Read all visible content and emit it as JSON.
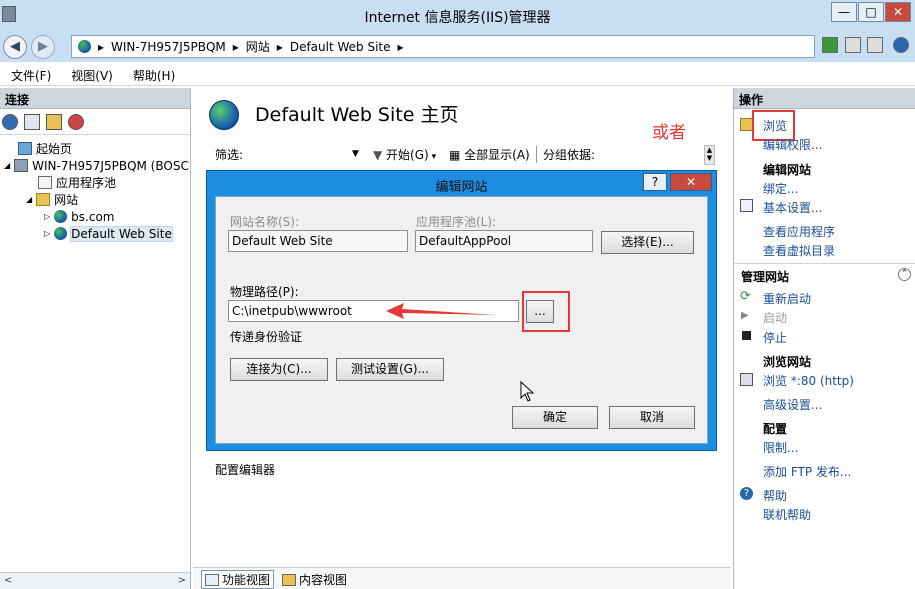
{
  "window": {
    "title": "Internet 信息服务(IIS)管理器",
    "controls": [
      "—",
      "□",
      "✕"
    ]
  },
  "address": {
    "crumbs": [
      "WIN-7H957J5PBQM",
      "网站",
      "Default Web Site"
    ],
    "sep": "▸"
  },
  "menu": [
    "文件(F)",
    "视图(V)",
    "帮助(H)"
  ],
  "left_panel": {
    "title": "连接",
    "tree": [
      {
        "label": "起始页",
        "level": 1,
        "icon": "home-icon"
      },
      {
        "label": "WIN-7H957J5PBQM (BOSC",
        "level": 0,
        "icon": "server-icon",
        "expander": "◢"
      },
      {
        "label": "应用程序池",
        "level": 1,
        "icon": "app-pool-icon"
      },
      {
        "label": "网站",
        "level": 1,
        "icon": "sites-folder-icon",
        "expander": "◢"
      },
      {
        "label": "bs.com",
        "level": 2,
        "icon": "globe-icon",
        "expander": "▷"
      },
      {
        "label": "Default Web Site",
        "level": 2,
        "icon": "globe-icon",
        "expander": "▷"
      }
    ],
    "scroll_left": "<",
    "scroll_right": ">"
  },
  "center": {
    "title": "Default Web Site 主页",
    "annotation": "或者",
    "filter_label": "筛选:",
    "start_label": "开始(G)",
    "show_all_label": "全部显示(A)",
    "group_by_label": "分组依据:",
    "feature_label": "配置编辑器",
    "tabs": [
      "功能视图",
      "内容视图"
    ]
  },
  "dialog": {
    "title": "编辑网站",
    "help": "?",
    "close": "✕",
    "site_name_label": "网站名称(S):",
    "site_name_value": "Default Web Site",
    "app_pool_label": "应用程序池(L):",
    "app_pool_value": "DefaultAppPool",
    "select_button": "选择(E)...",
    "physical_path_label": "物理路径(P):",
    "physical_path_value": "C:\\inetpub\\wwwroot",
    "browse_button": "...",
    "pass_auth_label": "传递身份验证",
    "connect_as_button": "连接为(C)...",
    "test_settings_button": "测试设置(G)...",
    "ok_button": "确定",
    "cancel_button": "取消"
  },
  "right_panel": {
    "title": "操作",
    "actions": {
      "browse": "浏览",
      "edit_permissions": "编辑权限...",
      "edit_site_header": "编辑网站",
      "bindings": "绑定...",
      "basic_settings": "基本设置...",
      "view_apps": "查看应用程序",
      "view_vdirs": "查看虚拟目录",
      "manage_site_header": "管理网站",
      "restart": "重新启动",
      "start": "启动",
      "stop": "停止",
      "browse_site_header": "浏览网站",
      "browse_port": "浏览 *:80 (http)",
      "advanced_settings": "高级设置...",
      "config_header": "配置",
      "limits": "限制...",
      "add_ftp": "添加 FTP 发布...",
      "help": "帮助",
      "online_help": "联机帮助"
    }
  },
  "colors": {
    "titlebar": "#c8dff3",
    "dialog_frame": "#1d8de0",
    "annotation_red": "#e53935",
    "link": "#1a4f9c"
  }
}
